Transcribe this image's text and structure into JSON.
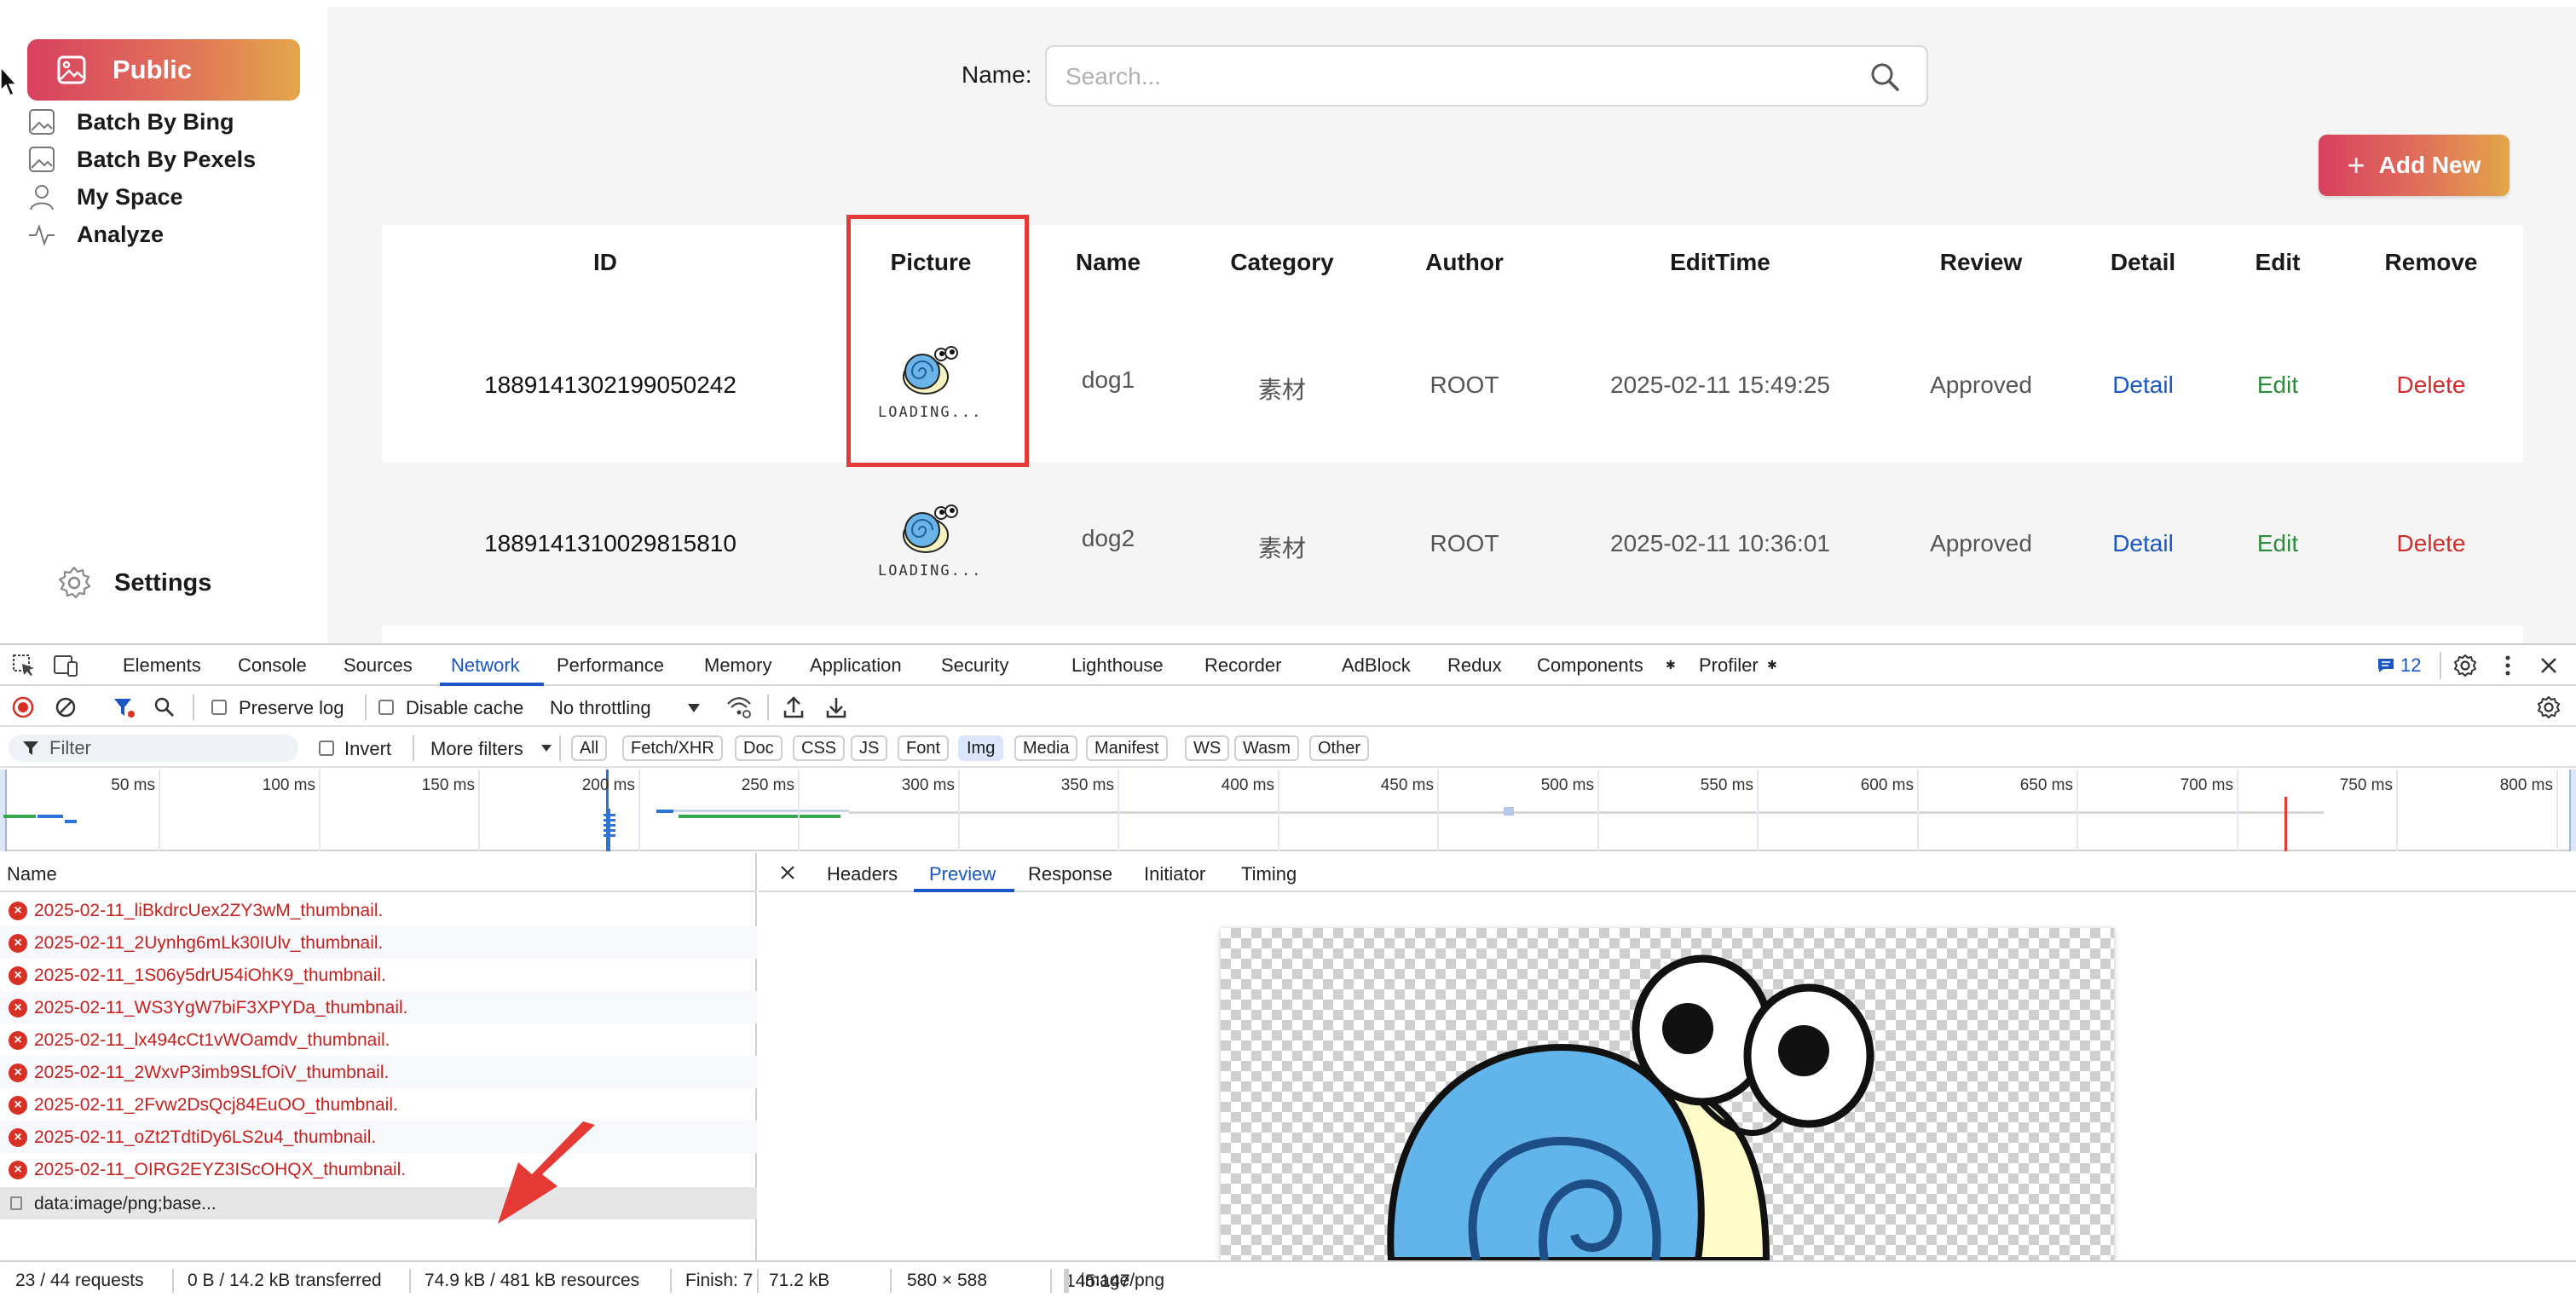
{
  "sidebar": {
    "active": {
      "label": "Public",
      "icon": "image-icon"
    },
    "items": [
      {
        "label": "Batch By Bing",
        "icon": "image-icon"
      },
      {
        "label": "Batch By Pexels",
        "icon": "image-icon"
      },
      {
        "label": "My Space",
        "icon": "user-icon"
      },
      {
        "label": "Analyze",
        "icon": "activity-icon"
      }
    ],
    "settings": {
      "label": "Settings",
      "icon": "gear-icon"
    }
  },
  "search": {
    "label": "Name:",
    "placeholder": "Search...",
    "value": ""
  },
  "add_button": {
    "label": "Add New"
  },
  "table": {
    "headers": [
      "ID",
      "Picture",
      "Name",
      "Category",
      "Author",
      "EditTime",
      "Review",
      "Detail",
      "Edit",
      "Remove"
    ],
    "rows": [
      {
        "id": "1889141302199050242",
        "loading": "LOADING...",
        "name": "dog1",
        "category": "素材",
        "author": "ROOT",
        "edit_time": "2025-02-11 15:49:25",
        "review": "Approved",
        "detail": "Detail",
        "edit": "Edit",
        "remove": "Delete"
      },
      {
        "id": "1889141310029815810",
        "loading": "LOADING...",
        "name": "dog2",
        "category": "素材",
        "author": "ROOT",
        "edit_time": "2025-02-11 10:36:01",
        "review": "Approved",
        "detail": "Detail",
        "edit": "Edit",
        "remove": "Delete"
      }
    ]
  },
  "devtools": {
    "tabs": [
      "Elements",
      "Console",
      "Sources",
      "Network",
      "Performance",
      "Memory",
      "Application",
      "Security",
      "Lighthouse",
      "Recorder",
      "AdBlock",
      "Redux",
      "Components",
      "Profiler"
    ],
    "active_tab": "Network",
    "issues_count": "12",
    "toolbar": {
      "preserve_log": "Preserve log",
      "disable_cache": "Disable cache",
      "throttling": "No throttling"
    },
    "filter": {
      "placeholder": "Filter",
      "invert": "Invert",
      "more_filters": "More filters",
      "types": [
        "All",
        "Fetch/XHR",
        "Doc",
        "CSS",
        "JS",
        "Font",
        "Img",
        "Media",
        "Manifest",
        "WS",
        "Wasm",
        "Other"
      ],
      "active_type": "Img"
    },
    "timeline": {
      "labels": [
        "50 ms",
        "100 ms",
        "150 ms",
        "200 ms",
        "250 ms",
        "300 ms",
        "350 ms",
        "400 ms",
        "450 ms",
        "500 ms",
        "550 ms",
        "600 ms",
        "650 ms",
        "700 ms",
        "750 ms",
        "800 ms"
      ]
    },
    "names_header": "Name",
    "requests": [
      "2025-02-11_liBkdrcUex2ZY3wM_thumbnail.",
      "2025-02-11_2Uynhg6mLk30IUlv_thumbnail.",
      "2025-02-11_1S06y5drU54iOhK9_thumbnail.",
      "2025-02-11_WS3YgW7biF3XPYDa_thumbnail.",
      "2025-02-11_lx494cCt1vWOamdv_thumbnail.",
      "2025-02-11_2WxvP3imb9SLfOiV_thumbnail.",
      "2025-02-11_2Fvw2DsQcj84EuOO_thumbnail.",
      "2025-02-11_oZt2TdtiDy6LS2u4_thumbnail.",
      "2025-02-11_OIRG2EYZ3IScOHQX_thumbnail."
    ],
    "selected_request": "data:image/png;base...",
    "detail_tabs": [
      "Headers",
      "Preview",
      "Response",
      "Initiator",
      "Timing"
    ],
    "active_detail_tab": "Preview",
    "status": {
      "requests": "23 / 44 requests",
      "transferred": "0 B / 14.2 kB transferred",
      "resources": "74.9 kB / 481 kB resources",
      "finish": "Finish: 7",
      "size": "71.2 kB",
      "dimensions": "580 × 588",
      "ratio": "145∶147",
      "mime": "image/png"
    }
  },
  "colors": {
    "accent_gradient_start": "#d8405f",
    "accent_gradient_end": "#e3a64a",
    "devtools_blue": "#1a56c4",
    "error_red": "#d93025",
    "highlight_red": "#e53935"
  }
}
